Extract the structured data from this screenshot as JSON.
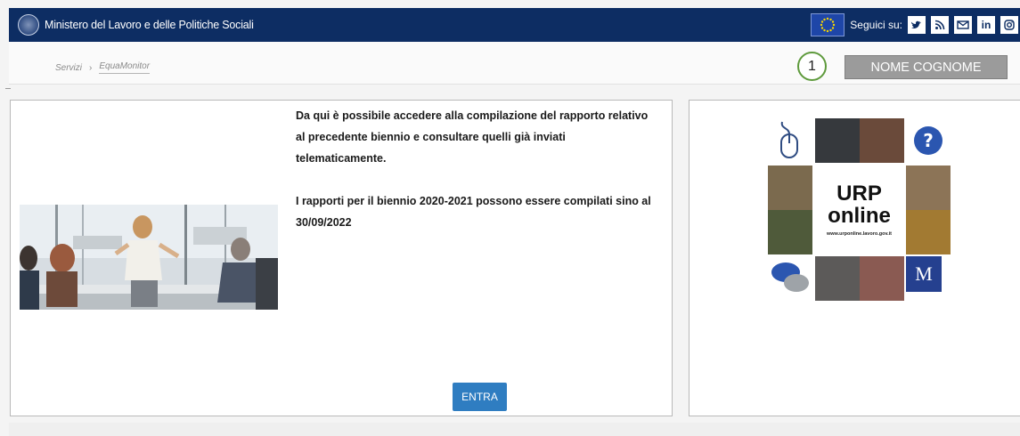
{
  "header": {
    "site_title": "Ministero del Lavoro e delle Politiche Sociali",
    "follow_label": "Seguici su:",
    "social_icons": [
      "twitter-icon",
      "rss-icon",
      "email-icon",
      "linkedin-icon",
      "instagram-icon"
    ]
  },
  "breadcrumb": {
    "items": [
      "Servizi",
      "EquaMonitor"
    ],
    "separator": "›"
  },
  "step_badge": "1",
  "user_button": "NOME COGNOME",
  "main": {
    "intro_1": "Da qui è possibile accedere alla compilazione del rapporto relativo al precedente biennio e consultare quelli già inviati telematicamente.",
    "intro_2": "I rapporti per il biennio 2020-2021 possono essere compilati sino al 30/09/2022",
    "enter_button": "ENTRA"
  },
  "urp": {
    "title": "URP",
    "subtitle": "online",
    "url": "www.urponline.lavoro.gov.it",
    "logo_letter": "M"
  },
  "colors": {
    "header_bg": "#0d2d63",
    "accent_button": "#2f7dc1",
    "user_button_bg": "#9b9b9b",
    "badge_border": "#5e9a3c",
    "urp_blue": "#25408f"
  }
}
